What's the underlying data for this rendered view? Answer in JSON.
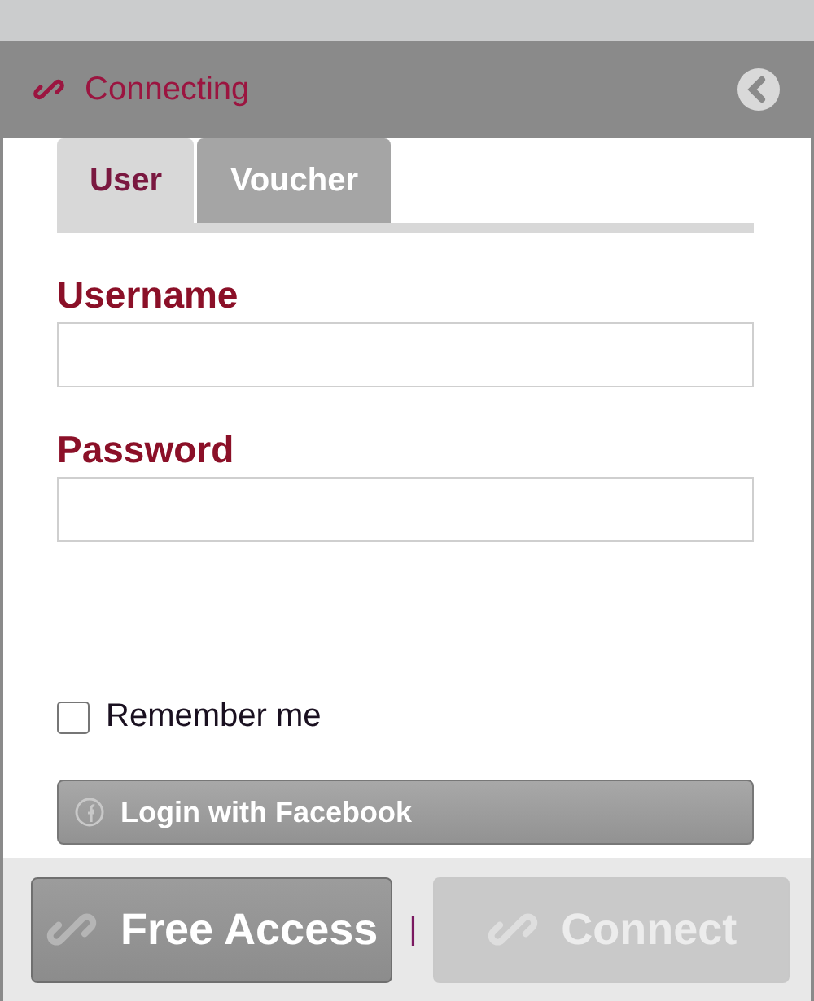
{
  "header": {
    "title": "Connecting"
  },
  "tabs": [
    {
      "label": "User",
      "selected": true
    },
    {
      "label": "Voucher",
      "selected": false
    }
  ],
  "fields": [
    {
      "label": "Username"
    },
    {
      "label": "Password"
    }
  ],
  "remember": {
    "label": "Remember me",
    "checked": false
  },
  "facebook_button": {
    "label": "Login with Facebook"
  },
  "footer": {
    "buttons": [
      {
        "label": "Free Access",
        "disabled": false
      },
      {
        "label": "Connect",
        "disabled": true
      }
    ],
    "separator": "|"
  }
}
